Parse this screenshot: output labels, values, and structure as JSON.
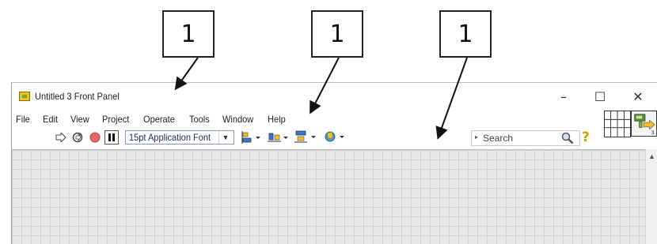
{
  "callouts": [
    "1",
    "1",
    "1"
  ],
  "window": {
    "title": "Untitled 3 Front Panel",
    "minimize": "–",
    "maximize": "☐",
    "close": "✕"
  },
  "menu": [
    "File",
    "Edit",
    "View",
    "Project",
    "Operate",
    "Tools",
    "Window",
    "Help"
  ],
  "toolbar": {
    "font_select": "15pt Application Font",
    "search_placeholder": "Search",
    "icons": [
      "run-arrow-icon",
      "run-continuously-icon",
      "abort-icon",
      "pause-icon",
      "align-objects-icon",
      "distribute-objects-icon",
      "resize-objects-icon",
      "reorder-icon",
      "search-icon",
      "help-icon"
    ]
  },
  "colors": {
    "canvas": "#e8e8e8",
    "grid": "#d2d2d2",
    "font_select_text": "#1a2b5a",
    "help": "#c8a000"
  }
}
